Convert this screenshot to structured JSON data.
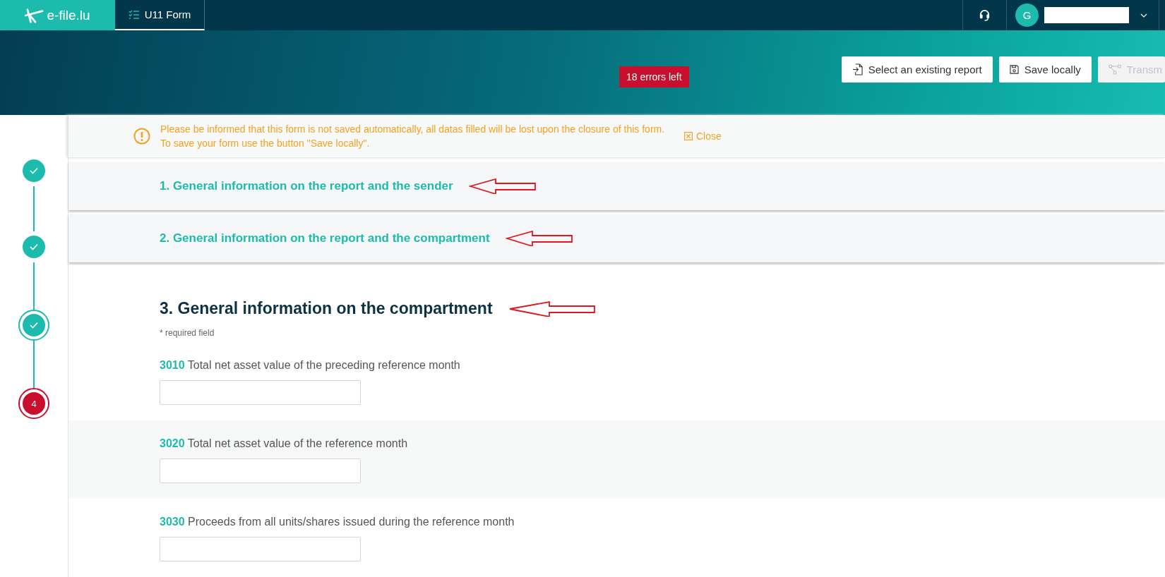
{
  "topbar": {
    "logo": "e-file.lu",
    "tab": {
      "label": "U11 Form",
      "selected": true
    },
    "avatar": "G"
  },
  "header": {
    "errors_badge": "18 errors left",
    "buttons": [
      {
        "label": "Select an existing report",
        "kind": "import",
        "disabled": false
      },
      {
        "label": "Save locally",
        "kind": "save",
        "disabled": false
      },
      {
        "label": "Transm",
        "kind": "transmit",
        "disabled": true
      }
    ]
  },
  "notice": {
    "text": "Please be informed that this form is not saved automatically, all datas filled will be lost upon the closure of this form. To save your form use the button \"Save locally\".",
    "close": "Close"
  },
  "steps": [
    {
      "complete": true,
      "current": false
    },
    {
      "complete": true,
      "current": false
    },
    {
      "complete": true,
      "current": true
    },
    {
      "complete": false,
      "current": true,
      "label": "4"
    }
  ],
  "sections": [
    {
      "title": "1. General information on the report and the sender",
      "expanded": false
    },
    {
      "title": "2. General information on the report and the compartment",
      "expanded": false
    },
    {
      "title": "3. General information on the compartment",
      "expanded": true
    }
  ],
  "required_note": "* required field",
  "fields": [
    {
      "code": "3010",
      "label": "Total net asset value of the preceding reference month"
    },
    {
      "code": "3020",
      "label": "Total net asset value of the reference month"
    },
    {
      "code": "3030",
      "label": "Proceeds from all units/shares issued during the reference month"
    }
  ]
}
